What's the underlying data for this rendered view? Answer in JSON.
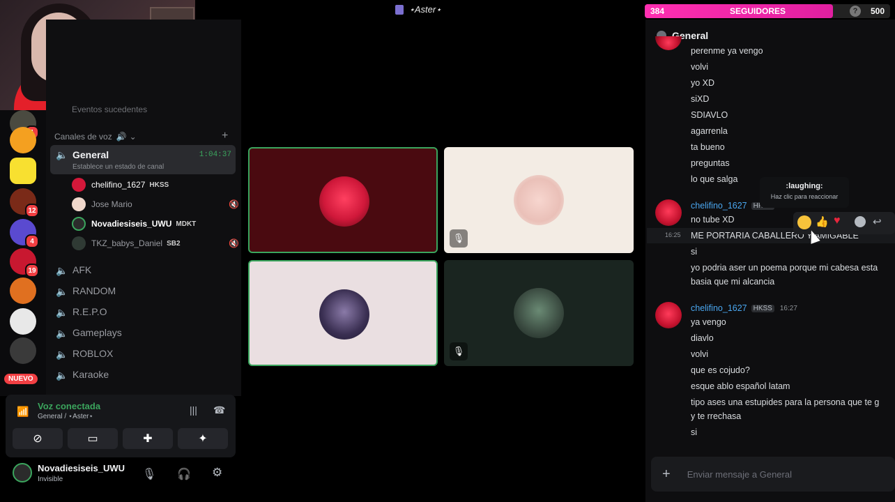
{
  "window": {
    "title": "⋆Aster⋆"
  },
  "follow_bar": {
    "current": "384",
    "label": "SEGUIDORES",
    "goal": "500",
    "progress": 0.768,
    "help": "?"
  },
  "channel_list": {
    "partial_top": "Eventos sucedentes",
    "voice_section": "Canales de voz",
    "active_channel": {
      "name": "General",
      "time": "1:04:37",
      "status": "Establece un estado de canal"
    },
    "members": [
      {
        "name": "chelifino_1627",
        "tag": "HKSS"
      },
      {
        "name": "Jose Mario",
        "tag": ""
      },
      {
        "name": "Novadiesiseis_UWU",
        "tag": "MDKT"
      },
      {
        "name": "TKZ_babys_Daniel",
        "tag": "SB2"
      }
    ],
    "channels": [
      "AFK",
      "RANDOM",
      "R.E.P.O",
      "Gameplays",
      "ROBLOX",
      "Karaoke"
    ]
  },
  "server_badges": [
    "1",
    "12",
    "4",
    "19"
  ],
  "new_label": "NUEVO",
  "voice_panel": {
    "status": "Voz conectada",
    "location": "General / ⋆Aster⋆"
  },
  "user": {
    "name": "Novadiesiseis_UWU",
    "status": "Invisible"
  },
  "chat": {
    "channel": "General",
    "messages_a": [
      "perenme ya vengo",
      "volvi",
      "yo XD",
      "siXD",
      "SDIAVLO",
      "agarrenla",
      "ta bueno",
      "preguntas",
      "lo que salga"
    ],
    "group_b": {
      "author": "chelifino_1627",
      "tag": "HKSS",
      "time_hover": "16:25",
      "lines": [
        "no tube XD",
        "ME PORTARIA CABALLERO Y AMIGABLE",
        "si",
        "yo podria aser un poema porque mi cabesa esta",
        "basia que mi alcancia"
      ]
    },
    "group_c": {
      "author": "chelifino_1627",
      "tag": "HKSS",
      "time": "16:27",
      "lines": [
        "ya vengo",
        "diavlo",
        "volvi",
        "que es cojudo?",
        "esque ablo español latam",
        "tipo ases una estupides para la persona que te g",
        "y te rrechasa",
        "si"
      ]
    },
    "tooltip": {
      "title": ":laughing:",
      "hint": "Haz clic para reaccionar"
    },
    "composer_placeholder": "Enviar mensaje a General"
  },
  "colors": {
    "accent_green": "#3ba55d",
    "mention_blue": "#4aa7f0",
    "follow_pink": "#ff2fb0",
    "badge_red": "#f23f43"
  }
}
